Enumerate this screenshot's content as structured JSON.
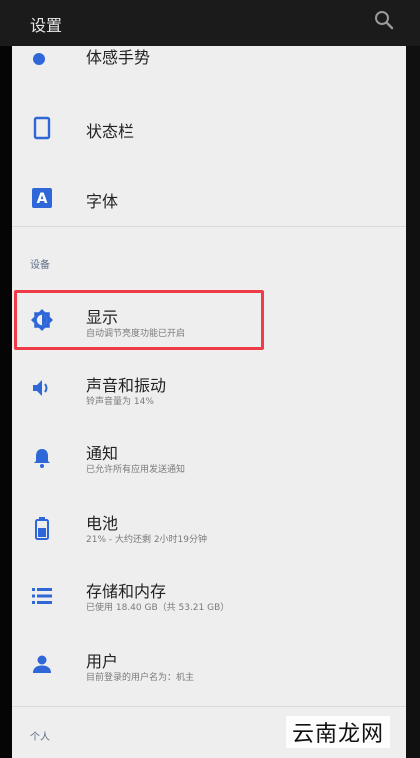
{
  "header": {
    "title": "设置"
  },
  "items_top": [
    {
      "label": "体感手势"
    },
    {
      "label": "状态栏"
    },
    {
      "label": "字体"
    }
  ],
  "section_device": "设备",
  "device_items": [
    {
      "label": "显示",
      "sub": "自动调节亮度功能已开启"
    },
    {
      "label": "声音和振动",
      "sub": "铃声音量为 14%"
    },
    {
      "label": "通知",
      "sub": "已允许所有应用发送通知"
    },
    {
      "label": "电池",
      "sub": "21% - 大约还剩 2小时19分钟"
    },
    {
      "label": "存储和内存",
      "sub": "已使用 18.40 GB（共 53.21 GB）"
    },
    {
      "label": "用户",
      "sub": "目前登录的用户名为：机主"
    }
  ],
  "section_personal": "个人",
  "watermark": "云南龙网",
  "colors": {
    "icon_blue": "#2f67d8",
    "highlight_red": "#ef3b45"
  }
}
